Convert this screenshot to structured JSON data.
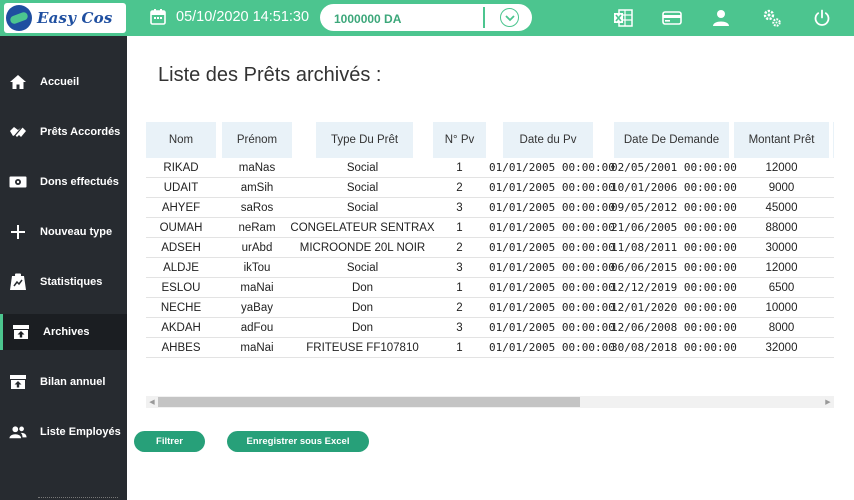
{
  "app": {
    "brand_name": "Easy Cos"
  },
  "header": {
    "datetime": "05/10/2020 14:51:30",
    "balance": "1000000 DA",
    "icons": [
      "calendar-icon",
      "excel-icon",
      "card-icon",
      "user-icon",
      "settings-icon",
      "power-icon"
    ]
  },
  "sidebar": {
    "items": [
      {
        "label": "Accueil",
        "icon": "home-icon"
      },
      {
        "label": "Prêts Accordés",
        "icon": "handshake-icon"
      },
      {
        "label": "Dons effectués",
        "icon": "money-icon"
      },
      {
        "label": "Nouveau type",
        "icon": "plus-icon"
      },
      {
        "label": "Statistiques",
        "icon": "chart-icon"
      },
      {
        "label": "Archives",
        "icon": "archive-icon",
        "active": true
      },
      {
        "label": "Bilan annuel",
        "icon": "archive-up-icon"
      },
      {
        "label": "Liste Employés",
        "icon": "people-icon"
      }
    ]
  },
  "main": {
    "title": "Liste des Prêts archivés :",
    "table": {
      "headers": [
        "Nom",
        "Prénom",
        "Type Du Prêt",
        "N° Pv",
        "Date du Pv",
        "Date De Demande",
        "Montant Prêt"
      ],
      "rows": [
        [
          "RIKAD",
          "maNas",
          "Social",
          "1",
          "01/01/2005 00:00:00",
          "02/05/2001 00:00:00",
          "12000"
        ],
        [
          "UDAIT",
          "amSih",
          "Social",
          "2",
          "01/01/2005 00:00:00",
          "10/01/2006 00:00:00",
          "9000"
        ],
        [
          "AHYEF",
          "saRos",
          "Social",
          "3",
          "01/01/2005 00:00:00",
          "09/05/2012 00:00:00",
          "45000"
        ],
        [
          "OUMAH",
          "neRam",
          "CONGELATEUR SENTRAX",
          "1",
          "01/01/2005 00:00:00",
          "21/06/2005 00:00:00",
          "88000"
        ],
        [
          "ADSEH",
          "urAbd",
          "MICROONDE 20L NOIR",
          "2",
          "01/01/2005 00:00:00",
          "11/08/2011 00:00:00",
          "30000"
        ],
        [
          "ALDJE",
          "ikTou",
          "Social",
          "3",
          "01/01/2005 00:00:00",
          "06/06/2015 00:00:00",
          "12000"
        ],
        [
          "ESLOU",
          "maNai",
          "Don",
          "1",
          "01/01/2005 00:00:00",
          "12/12/2019 00:00:00",
          "6500"
        ],
        [
          "NECHE",
          "yaBay",
          "Don",
          "2",
          "01/01/2005 00:00:00",
          "12/01/2020 00:00:00",
          "10000"
        ],
        [
          "AKDAH",
          "adFou",
          "Don",
          "3",
          "01/01/2005 00:00:00",
          "12/06/2008 00:00:00",
          "8000"
        ],
        [
          "AHBES",
          "maNai",
          "FRITEUSE FF107810",
          "1",
          "01/01/2005 00:00:00",
          "30/08/2018 00:00:00",
          "32000"
        ]
      ]
    },
    "buttons": {
      "filter": "Filtrer",
      "export": "Enregistrer sous Excel"
    }
  },
  "colors": {
    "accent": "#4cc58f",
    "sidebar": "#272b30",
    "button": "#27a079",
    "header_cell": "#e9f2f8"
  }
}
